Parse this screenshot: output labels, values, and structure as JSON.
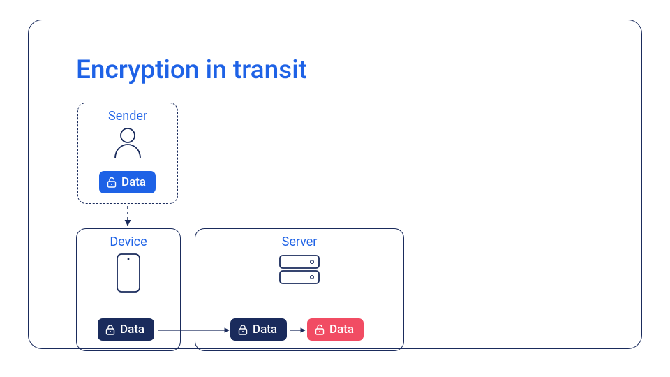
{
  "title": "Encryption in transit",
  "sender": {
    "label": "Sender",
    "pill": "Data"
  },
  "device": {
    "label": "Device",
    "pill": "Data"
  },
  "server": {
    "label": "Server",
    "pill_locked": "Data",
    "pill_unlocked": "Data"
  },
  "colors": {
    "accent_blue": "#1E62E6",
    "navy": "#1A2B5C",
    "red": "#F14C63"
  }
}
